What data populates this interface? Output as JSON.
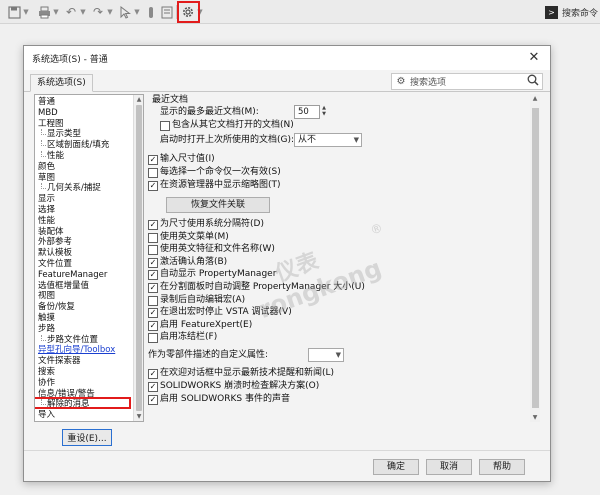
{
  "toolbar": {
    "icons": [
      "save-icon",
      "print-icon",
      "undo-icon",
      "redo-icon",
      "select-icon",
      "rebuild-icon",
      "file-properties-icon",
      "options-gear-icon"
    ],
    "command_search": "搜索命令"
  },
  "dialog": {
    "title": "系统选项(S) - 普通",
    "close_glyph": "✕",
    "tab_label": "系统选项(S)",
    "search_placeholder": "搜索选项"
  },
  "tree": {
    "items": [
      {
        "label": "普通",
        "indent": 0
      },
      {
        "label": "MBD",
        "indent": 0
      },
      {
        "label": "工程图",
        "indent": 0
      },
      {
        "label": "显示类型",
        "indent": 1
      },
      {
        "label": "区域剖面线/填充",
        "indent": 1
      },
      {
        "label": "性能",
        "indent": 1
      },
      {
        "label": "颜色",
        "indent": 0
      },
      {
        "label": "草图",
        "indent": 0
      },
      {
        "label": "几何关系/捕捉",
        "indent": 1
      },
      {
        "label": "显示",
        "indent": 0
      },
      {
        "label": "选择",
        "indent": 0
      },
      {
        "label": "性能",
        "indent": 0
      },
      {
        "label": "装配体",
        "indent": 0
      },
      {
        "label": "外部参考",
        "indent": 0
      },
      {
        "label": "默认模板",
        "indent": 0
      },
      {
        "label": "文件位置",
        "indent": 0
      },
      {
        "label": "FeatureManager",
        "indent": 0
      },
      {
        "label": "选值框增量值",
        "indent": 0
      },
      {
        "label": "视图",
        "indent": 0
      },
      {
        "label": "备份/恢复",
        "indent": 0
      },
      {
        "label": "触摸",
        "indent": 0
      },
      {
        "label": "步路",
        "indent": 0
      },
      {
        "label": "步路文件位置",
        "indent": 1
      },
      {
        "label": "异型孔向导/Toolbox",
        "indent": 0,
        "selected": true
      },
      {
        "label": "文件探索器",
        "indent": 0
      },
      {
        "label": "搜索",
        "indent": 0
      },
      {
        "label": "协作",
        "indent": 0
      },
      {
        "label": "信息/错误/警告",
        "indent": 0
      },
      {
        "label": "解除的消息",
        "indent": 1
      },
      {
        "label": "导入",
        "indent": 0
      }
    ],
    "reset_label": "重设(E)..."
  },
  "panel": {
    "recent_header": "最近文档",
    "max_recent_label": "显示的最多最近文档(M):",
    "max_recent_value": "50",
    "include_other_label": "包含从其它文档打开的文档(N)",
    "include_other_checked": false,
    "open_last_label": "启动时打开上次所使用的文档(G):",
    "open_last_value": "从不",
    "options": [
      {
        "label": "输入尺寸值(I)",
        "checked": true
      },
      {
        "label": "每选择一个命令仅一次有效(S)",
        "checked": false
      },
      {
        "label": "在资源管理器中显示缩略图(T)",
        "checked": true
      }
    ],
    "recover_button": "恢复文件关联",
    "options2": [
      {
        "label": "为尺寸使用系统分隔符(D)",
        "checked": true
      },
      {
        "label": "使用英文菜单(M)",
        "checked": false
      },
      {
        "label": "使用英文特征和文件名称(W)",
        "checked": false
      },
      {
        "label": "激活确认角落(B)",
        "checked": true
      },
      {
        "label": "自动显示 PropertyManager",
        "checked": true
      },
      {
        "label": "在分割面板时自动调整 PropertyManager 大小(U)",
        "checked": true
      },
      {
        "label": "录制后自动编辑宏(A)",
        "checked": false
      },
      {
        "label": "在退出宏时停止 VSTA 调试器(V)",
        "checked": true
      },
      {
        "label": "启用 FeatureXpert(E)",
        "checked": true
      },
      {
        "label": "启用冻结栏(F)",
        "checked": false
      }
    ],
    "describe_label": "作为零部件描述的自定义属性:",
    "describe_value": "",
    "options3": [
      {
        "label": "在欢迎对话框中显示最新技术提醒和新闻(L)",
        "checked": true
      },
      {
        "label": "SOLIDWORKS 崩溃时检查解决方案(O)",
        "checked": true
      },
      {
        "label": "启用 SOLIDWORKS 事件的声音",
        "checked": true
      }
    ]
  },
  "watermark": {
    "line1": "仪表",
    "line2": "rongkong",
    "reg": "®"
  },
  "buttons": {
    "ok": "确定",
    "cancel": "取消",
    "help": "帮助"
  },
  "colors": {
    "highlight_red": "#e21b1b",
    "selected_link": "#1a3fd0"
  }
}
